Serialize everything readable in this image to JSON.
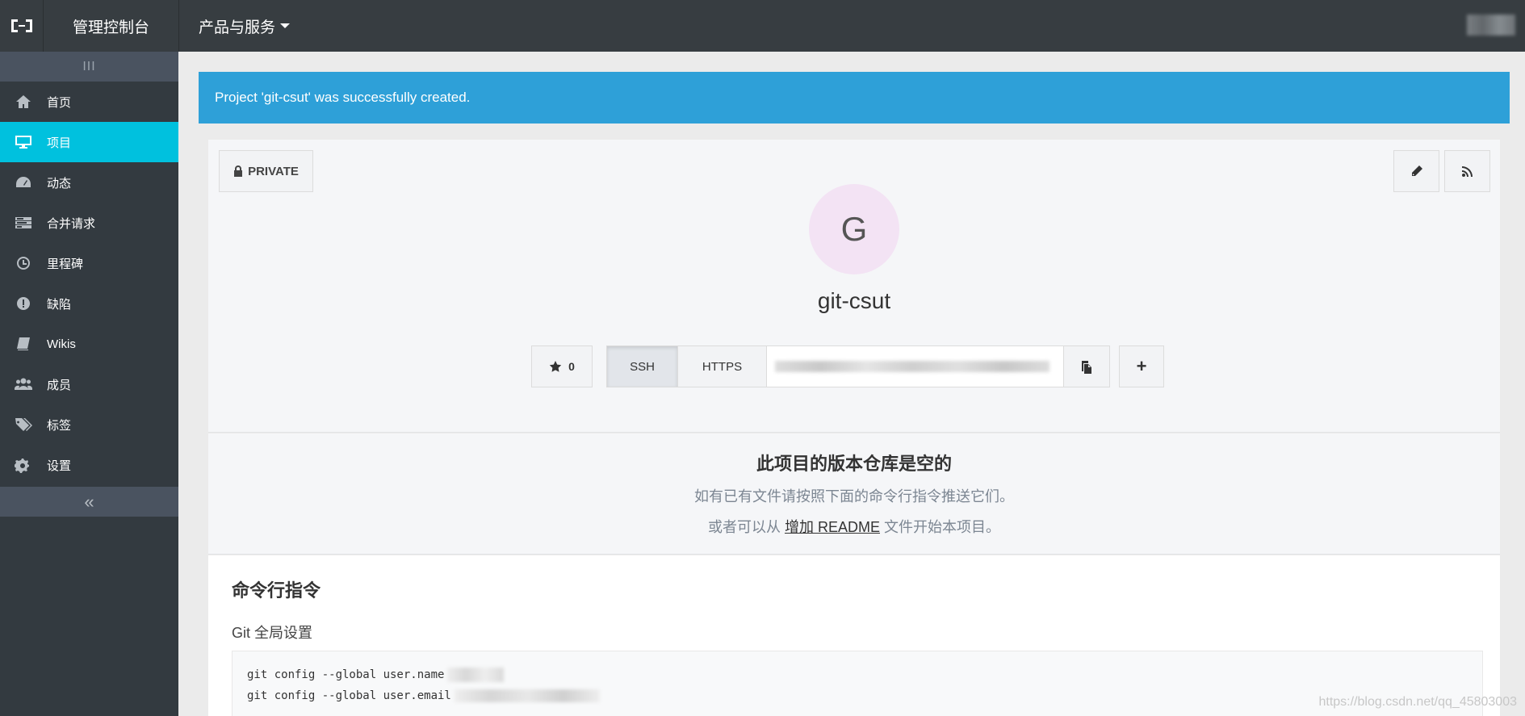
{
  "header": {
    "console_title": "管理控制台",
    "products_label": "产品与服务"
  },
  "sidebar": {
    "toggle_glyph": "III",
    "collapse_glyph": "«",
    "items": [
      {
        "label": "首页",
        "icon": "home-icon"
      },
      {
        "label": "项目",
        "icon": "monitor-icon",
        "active": true
      },
      {
        "label": "动态",
        "icon": "dashboard-icon"
      },
      {
        "label": "合并请求",
        "icon": "tasks-icon"
      },
      {
        "label": "里程碑",
        "icon": "clock-icon"
      },
      {
        "label": "缺陷",
        "icon": "exclamation-icon"
      },
      {
        "label": "Wikis",
        "icon": "book-icon"
      },
      {
        "label": "成员",
        "icon": "users-icon"
      },
      {
        "label": "标签",
        "icon": "tags-icon"
      },
      {
        "label": "设置",
        "icon": "gears-icon"
      }
    ]
  },
  "alert": {
    "message": "Project 'git-csut' was successfully created."
  },
  "project": {
    "visibility": "PRIVATE",
    "avatar_letter": "G",
    "name": "git-csut",
    "star_count": "0",
    "clone_ssh": "SSH",
    "clone_https": "HTTPS",
    "plus": "+"
  },
  "empty_repo": {
    "title": "此项目的版本仓库是空的",
    "line1": "如有已有文件请按照下面的命令行指令推送它们。",
    "line2_prefix": "或者可以从",
    "line2_link": "增加 README",
    "line2_suffix": "文件开始本项目。"
  },
  "command_line": {
    "title": "命令行指令",
    "global_setup": "Git 全局设置",
    "code_line1": "git config --global user.name",
    "code_line2": "git config --global user.email"
  },
  "watermark": "https://blog.csdn.net/qq_45803003",
  "colors": {
    "topbar": "#373d41",
    "sidebar": "#333a40",
    "active": "#00c1de",
    "alert": "#2ea0d8"
  }
}
